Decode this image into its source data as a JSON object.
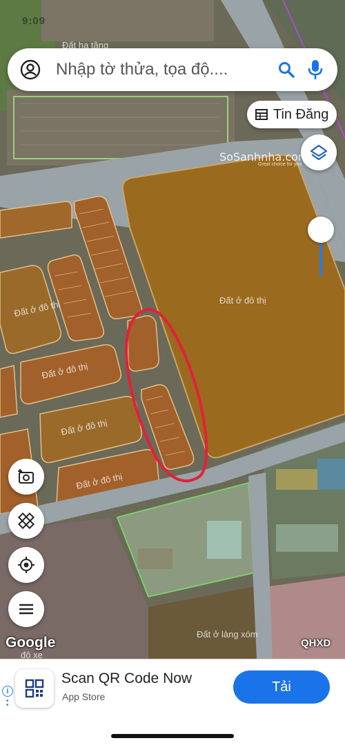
{
  "status": {
    "time": "9:09"
  },
  "search": {
    "placeholder": "Nhập tờ thửa, tọa độ...."
  },
  "tin_dang": {
    "label": "Tin Đăng"
  },
  "watermark": {
    "brand": "SoSanhnha.com",
    "tagline": "Great choice for you"
  },
  "map": {
    "labels": {
      "top_field": "Đất hạ tầng",
      "big_parcel": "Đất ở đô thị",
      "left_block": "Đất ở đô thị",
      "middle_block": "Đất ở đô thị",
      "lower_block": "Đất ở đô thị",
      "lower_block2": "Đất ở đô thị",
      "bottom_right": "Đất ở làng xóm",
      "bottom_left": "đô xe"
    },
    "attribution": "Google",
    "layer_code": "QHXD"
  },
  "icons": {
    "account": "account-circle-icon",
    "search": "search-icon",
    "mic": "mic-icon",
    "listing": "table-icon",
    "layers": "layers-icon",
    "add_photo": "add-photo-icon",
    "measure": "ruler-icon",
    "locate": "my-location-icon",
    "menu": "menu-icon",
    "qr": "qr-code-icon"
  },
  "ad": {
    "title": "Scan QR Code Now",
    "subtitle": "App Store",
    "cta": "Tải",
    "info_label": "i"
  },
  "colors": {
    "parcel_urban": "#9a6a1f",
    "road": "#9aa3a8",
    "highlight_ring": "#e3203a",
    "accent": "#1a73e8"
  }
}
